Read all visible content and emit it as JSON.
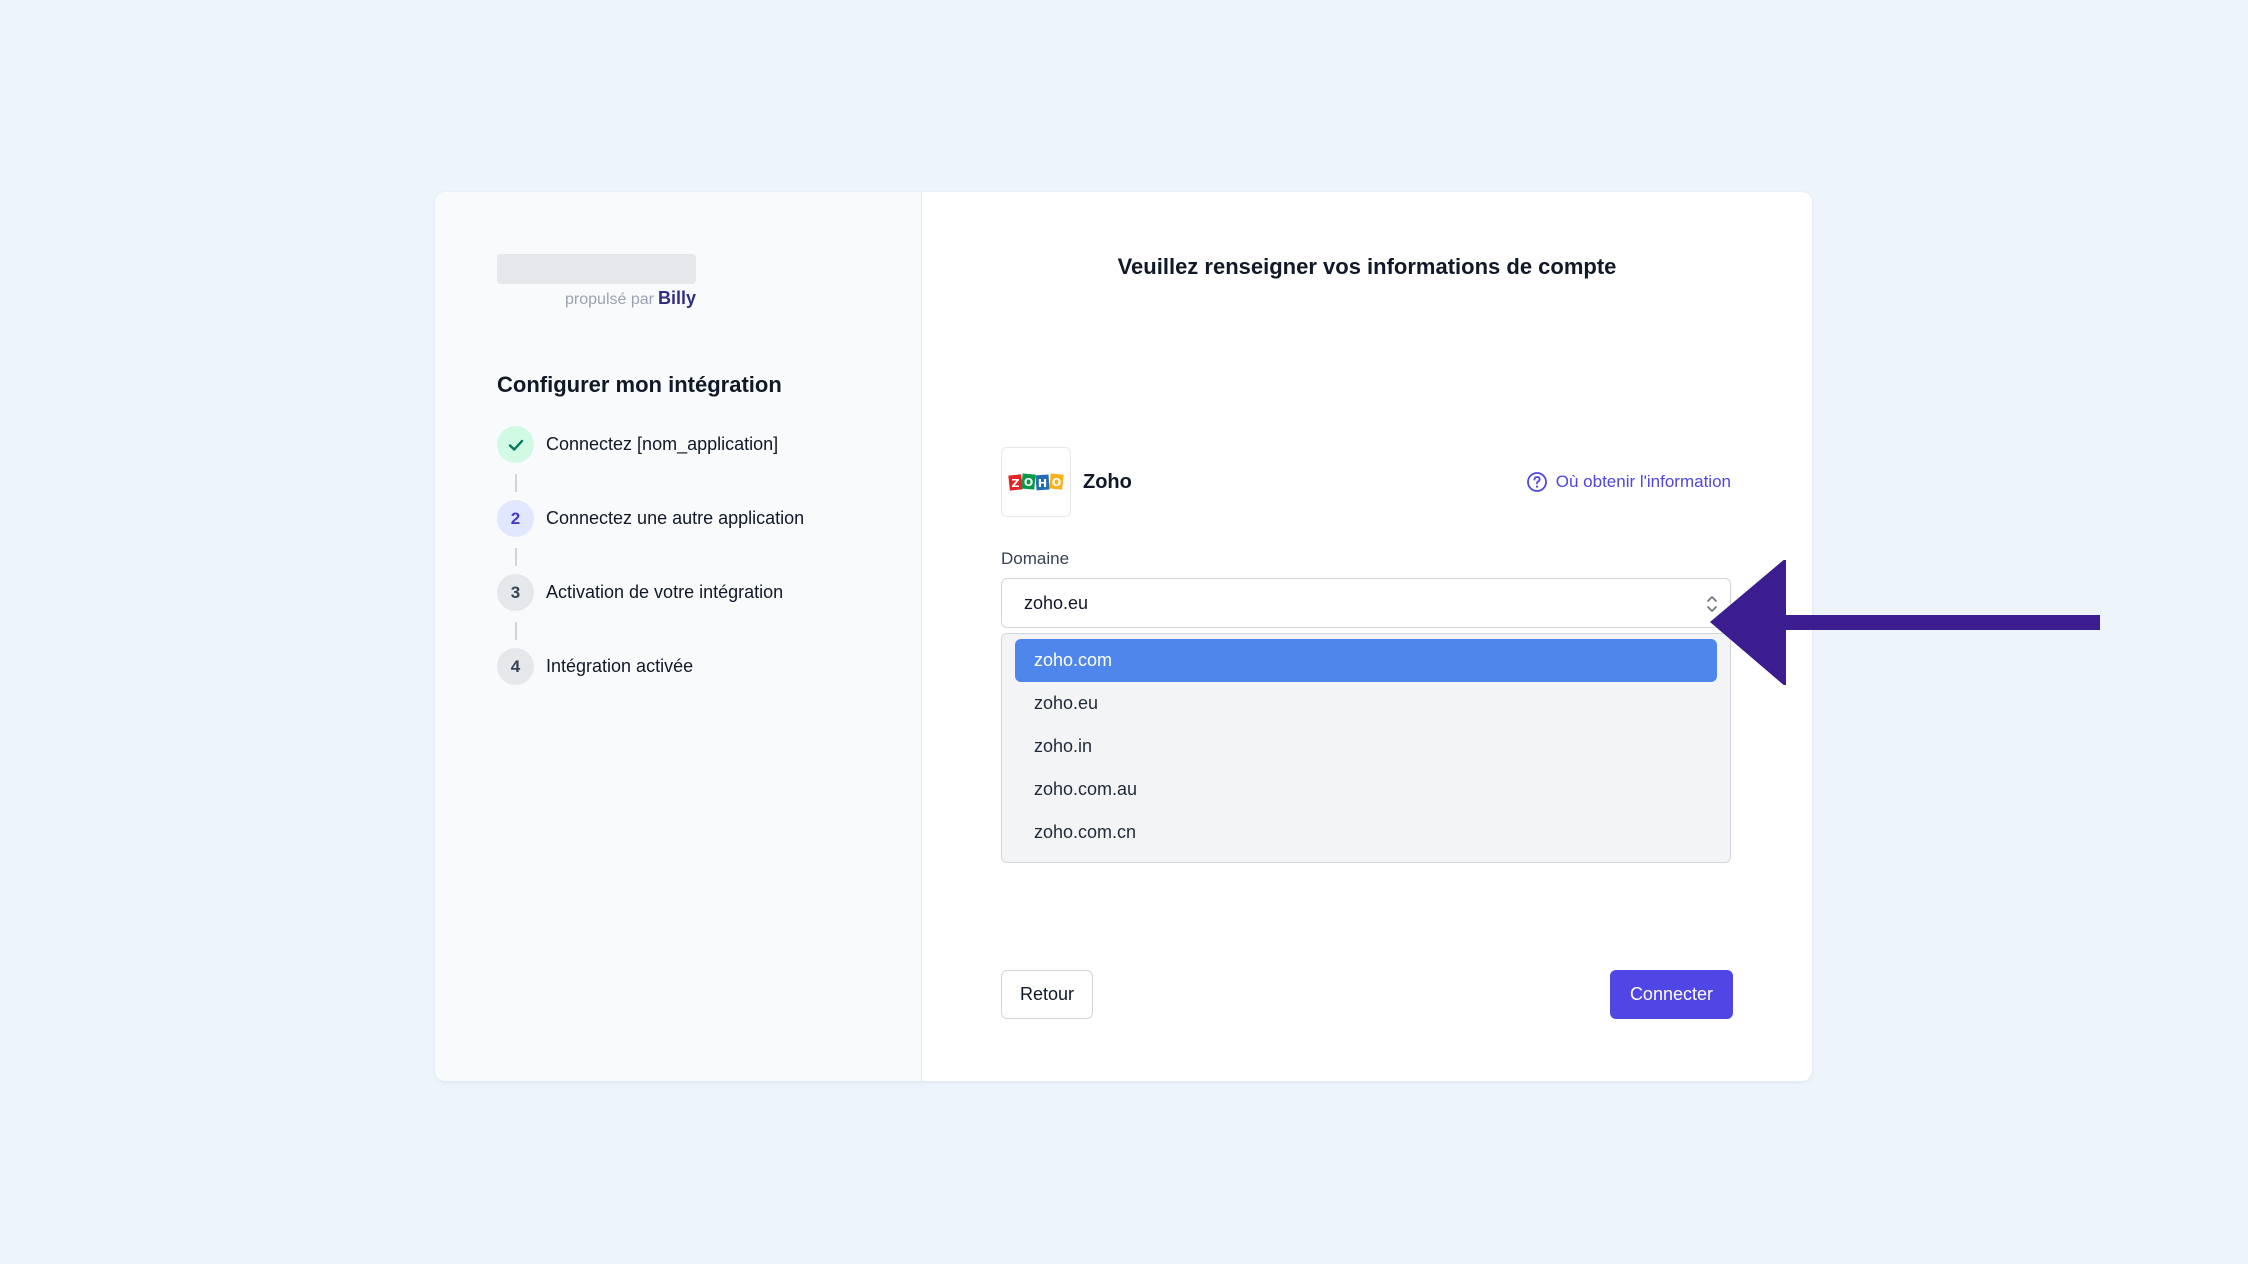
{
  "sidebar": {
    "powered_by": "propulsé par",
    "brand": "Billy",
    "title": "Configurer mon intégration",
    "steps": [
      {
        "number": "",
        "label": "Connectez [nom_application]",
        "status": "done"
      },
      {
        "number": "2",
        "label": "Connectez une autre application",
        "status": "active"
      },
      {
        "number": "3",
        "label": "Activation de votre intégration",
        "status": "todo"
      },
      {
        "number": "4",
        "label": "Intégration activée",
        "status": "todo"
      }
    ]
  },
  "main": {
    "title": "Veuillez renseigner vos informations de compte",
    "app_name": "Zoho",
    "help_link": "Où obtenir l'information",
    "domain_label": "Domaine",
    "domain_value": "zoho.eu",
    "domain_options": [
      "zoho.com",
      "zoho.eu",
      "zoho.in",
      "zoho.com.au",
      "zoho.com.cn"
    ],
    "highlighted_option": "zoho.com",
    "back_button": "Retour",
    "connect_button": "Connecter"
  },
  "colors": {
    "accent": "#4f46e5",
    "arrow": "#3b1d8f",
    "highlight": "#4f86ec"
  }
}
